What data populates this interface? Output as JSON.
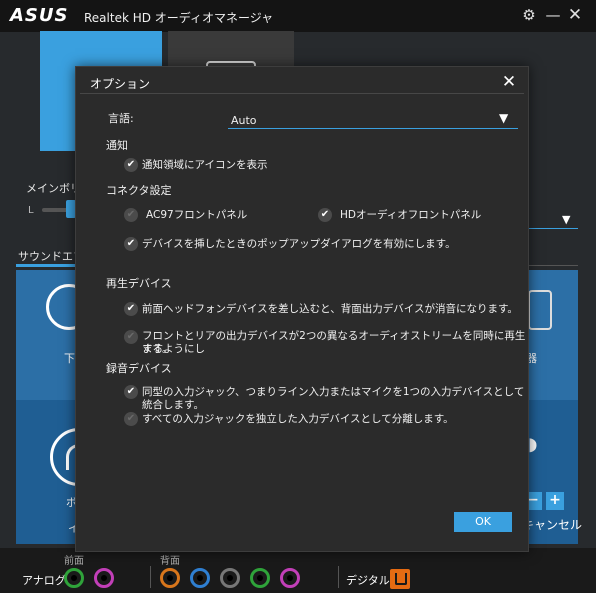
{
  "titlebar": {
    "brand": "ASUS",
    "title": "Realtek HD オーディオマネージャ",
    "settings_icon": "gear-icon",
    "minimize_icon": "minimize-icon",
    "close_icon": "close-icon"
  },
  "background": {
    "volume_label": "メインボリュー",
    "volume_left": "L",
    "sound_tab": "サウンドエフ",
    "side_texts": [
      "下",
      "器",
      "ボ",
      "イ"
    ],
    "cancel_label": "キャンセル",
    "minus_label": "−",
    "plus_label": "+"
  },
  "jacks": {
    "front_label": "前面",
    "rear_label": "背面",
    "analog_label": "アナログ",
    "digital_label": "デジタル",
    "colors": {
      "green": "#2fa33a",
      "pink": "#c23fb8",
      "orange": "#d8761c",
      "blue": "#2f7fd1",
      "black": "#777777",
      "optical": "#e66b12"
    }
  },
  "modal": {
    "title": "オプション",
    "language": {
      "label": "言語:",
      "value": "Auto"
    },
    "notify": {
      "heading": "通知",
      "options": [
        {
          "label": "通知領域にアイコンを表示",
          "checked": true
        }
      ]
    },
    "connector": {
      "heading": "コネクタ設定",
      "ac97": {
        "label": "AC97フロントパネル",
        "checked": false
      },
      "hd": {
        "label": "HDオーディオフロントパネル",
        "checked": true
      },
      "popup": {
        "label": "デバイスを挿したときのポップアップダイアログを有効にします。",
        "checked": true
      }
    },
    "playback": {
      "heading": "再生デバイス",
      "opt1": {
        "label": "前面ヘッドフォンデバイスを差し込むと、背面出力デバイスが消音になります。",
        "checked": true
      },
      "opt2_line1": "フロントとリアの出力デバイスが2つの異なるオーディオストリームを同時に再生するようにし",
      "opt2_line2": "ます。",
      "opt2_checked": false
    },
    "recording": {
      "heading": "録音デバイス",
      "opt1": {
        "label": "同型の入力ジャック、つまりライン入力またはマイクを1つの入力デバイスとして統合します。",
        "checked": true
      },
      "opt2": {
        "label": "すべての入力ジャックを独立した入力デバイスとして分離します。",
        "checked": false
      }
    },
    "ok_label": "OK",
    "accent": "#3aa0df"
  }
}
